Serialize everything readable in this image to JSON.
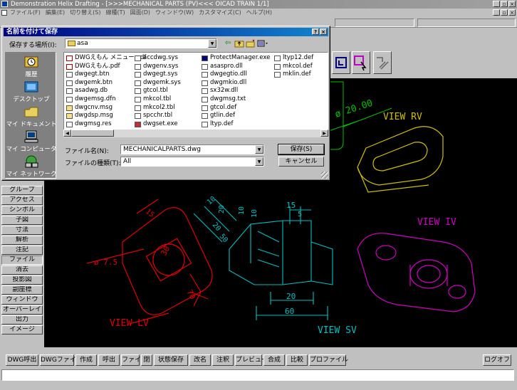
{
  "window": {
    "title": "Demonstration Helix Drafting - [>>>MECHANICAL PARTS   (PV)<<< OICAD TRAIN   1/1]"
  },
  "menu": [
    "ファイル(F)",
    "編集(E)",
    "切り替え(S)",
    "線種(T)",
    "図面(D)",
    "ウィンドウ(W)",
    "カスタマイズ(C)",
    "ヘルプ(H)"
  ],
  "dialog": {
    "title": "名前を付けて保存",
    "location_label": "保存する場所(I):",
    "location_value": "asa",
    "places": [
      "履歴",
      "デスクトップ",
      "マイ ドキュメント",
      "マイ コンピュータ",
      "マイ ネットワーク"
    ],
    "files": [
      [
        "DWGえもん メニュー.pdf",
        "DWGえもん.pdf",
        "dwgegt.btn",
        "dwgemk.btn",
        "asadwg.db",
        "dwgemsg.dfn",
        "dwgcnv.msg",
        "dwgdsp.msg",
        "dwgmsg.res"
      ],
      [
        "accdwg.sys",
        "dwgenv.sys",
        "dwgegt.sys",
        "dwgemk.sys",
        "gtcol.tbl",
        "mkcol.tbl",
        "mkcol2.tbl",
        "spcchr.tbl",
        "dwgset.exe"
      ],
      [
        "ProtectManager.exe",
        "asaspro.dll",
        "dwgegtio.dll",
        "dwgmkio.dll",
        "sx32w.dll",
        "dwgmsg.txt",
        "gtcol.def",
        "gtlin.def",
        "ltyp.def"
      ],
      [
        "ltyp12.def",
        "mkcol.def",
        "mklin.def"
      ]
    ],
    "filename_label": "ファイル名(N):",
    "filename_value": "MECHANICALPARTS.dwg",
    "filetype_label": "ファイルの種類(T):",
    "filetype_value": "All",
    "save_button": "保存(S)",
    "cancel_button": "キャンセル"
  },
  "sidebar": [
    "グループ",
    "アクセス",
    "シンボル",
    "子図",
    "寸法",
    "解析",
    "注記",
    "ファイル",
    "消去",
    "投影図",
    "副座標",
    "ウィンドウ",
    "オーバーレイ",
    "出力",
    "イメージ"
  ],
  "bottom_buttons": [
    "DWG呼出",
    "DWGファイル",
    "作成",
    "呼出",
    "ファイル",
    "閉",
    "状態保存",
    "改名",
    "注釈",
    "プレビュー",
    "合成",
    "比較",
    "プロファイル"
  ],
  "logoff_button": "ログオフ",
  "drawing": {
    "views": [
      "VIEW RV",
      "VIEW IV",
      "VIEW LV",
      "VIEW SV"
    ],
    "dimensions": [
      "ø 20.00",
      "15",
      "5",
      "10",
      "20",
      "10",
      "20",
      "50",
      "10",
      "20",
      "60",
      "15",
      "ø 7.5",
      "30",
      "70",
      "10"
    ]
  }
}
